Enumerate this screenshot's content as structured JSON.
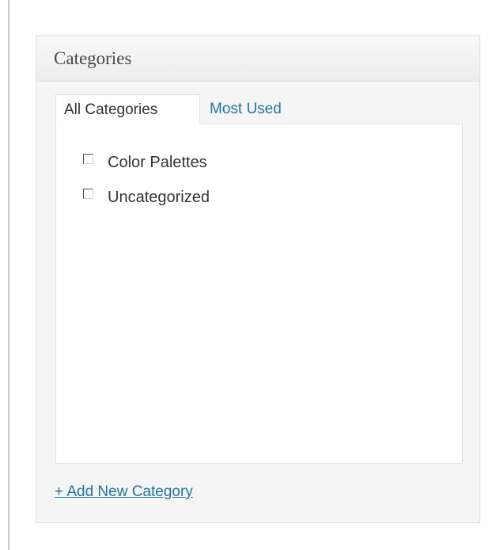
{
  "metabox": {
    "title": "Categories"
  },
  "tabs": [
    {
      "label": "All Categories",
      "active": true
    },
    {
      "label": "Most Used",
      "active": false
    }
  ],
  "categories": [
    {
      "label": "Color Palettes",
      "checked": false
    },
    {
      "label": "Uncategorized",
      "checked": false
    }
  ],
  "add_new": {
    "label": "+ Add New Category"
  },
  "colors": {
    "link": "#21759b",
    "text": "#333333",
    "border": "#dfdfdf"
  }
}
